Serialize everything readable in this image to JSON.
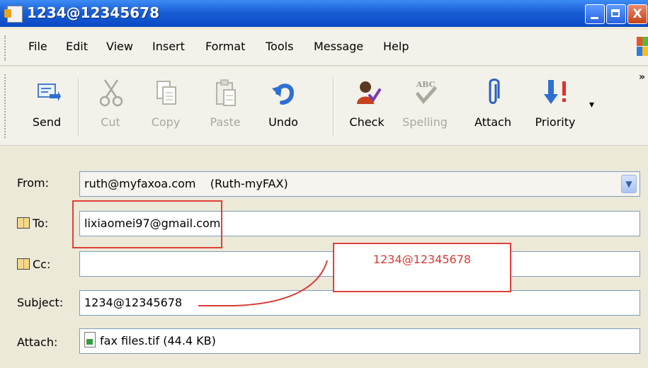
{
  "window": {
    "title": "1234@12345678",
    "minimize_label": "",
    "maximize_label": "",
    "close_label": "X"
  },
  "menu": [
    "File",
    "Edit",
    "View",
    "Insert",
    "Format",
    "Tools",
    "Message",
    "Help"
  ],
  "toolbar": {
    "send": "Send",
    "cut": "Cut",
    "copy": "Copy",
    "paste": "Paste",
    "undo": "Undo",
    "check": "Check",
    "spelling": "Spelling",
    "attach": "Attach",
    "priority": "Priority",
    "spell_icon_text": "ABC",
    "more": "»"
  },
  "fields": {
    "from_label": "From:",
    "from_value": "ruth@myfaxoa.com    (Ruth-myFAX)",
    "to_label": "To:",
    "to_value": "lixiaomei97@gmail.com",
    "cc_label": "Cc:",
    "cc_value": "",
    "subject_label": "Subject:",
    "subject_value": "1234@12345678",
    "attach_label": "Attach:",
    "attach_value": "fax files.tif (44.4 KB)"
  },
  "annotation": {
    "callout_text": "1234@12345678"
  },
  "icons": {
    "send": "send-icon",
    "cut": "scissors-icon",
    "copy": "copy-icon",
    "paste": "paste-icon",
    "undo": "undo-icon",
    "check": "check-names-icon",
    "spelling": "spelling-icon",
    "attach": "paperclip-icon",
    "priority": "priority-icon",
    "address_book": "address-book-icon",
    "file": "tif-file-icon"
  },
  "colors": {
    "title_bar": "#1A5FD6",
    "highlight": "#E0403A",
    "callout_text": "#D83A36",
    "disabled_text": "#A9A89D"
  }
}
